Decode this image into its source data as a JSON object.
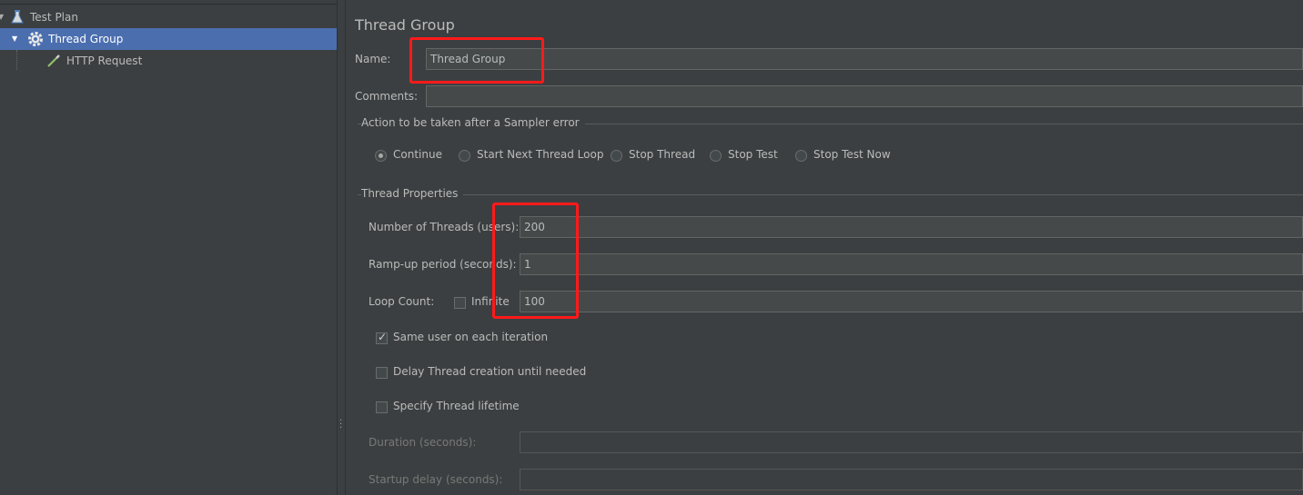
{
  "tree": {
    "items": [
      {
        "label": "Test Plan",
        "icon": "flask-icon"
      },
      {
        "label": "Thread Group",
        "icon": "gear-icon",
        "selected": true
      },
      {
        "label": "HTTP Request",
        "icon": "pipette-icon"
      }
    ]
  },
  "panel": {
    "title": "Thread Group",
    "name_label": "Name:",
    "name_value": "Thread Group",
    "comments_label": "Comments:",
    "comments_value": "",
    "sampler_error": {
      "title": "Action to be taken after a Sampler error",
      "options": [
        "Continue",
        "Start Next Thread Loop",
        "Stop Thread",
        "Stop Test",
        "Stop Test Now"
      ],
      "selected": "Continue"
    },
    "thread_properties": {
      "title": "Thread Properties",
      "threads_label": "Number of Threads (users):",
      "threads_value": "200",
      "rampup_label": "Ramp-up period (seconds):",
      "rampup_value": "1",
      "loop_label": "Loop Count:",
      "infinite_label": "Infinite",
      "infinite_checked": false,
      "loop_value": "100",
      "same_user_label": "Same user on each iteration",
      "same_user_checked": true,
      "delay_label": "Delay Thread creation until needed",
      "delay_checked": false,
      "lifetime_label": "Specify Thread lifetime",
      "lifetime_checked": false,
      "duration_label": "Duration (seconds):",
      "duration_value": "",
      "startup_label": "Startup delay (seconds):",
      "startup_value": ""
    }
  },
  "colors": {
    "background": "#3c3f41",
    "selection": "#4b6eaf",
    "highlight": "#ff1a1a"
  }
}
